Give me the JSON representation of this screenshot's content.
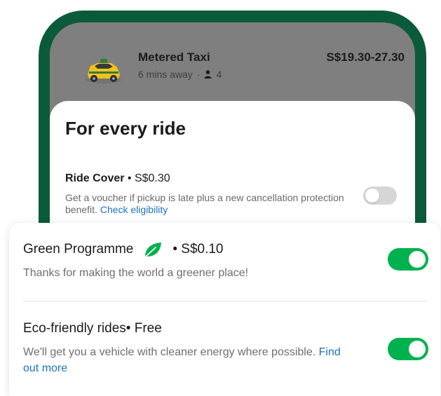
{
  "ride": {
    "name": "Metered Taxi",
    "eta": "6 mins away",
    "separator": "·",
    "seats": "4",
    "price": "S$19.30-27.30"
  },
  "sheet": {
    "title": "For every ride",
    "ride_cover": {
      "label": "Ride Cover",
      "price": " • S$0.30",
      "description": "Get a voucher if pickup is late plus a new cancellation protection benefit.",
      "link": "Check eligibility",
      "enabled": false
    }
  },
  "card": {
    "green_programme": {
      "label": "Green Programme",
      "price": "• S$0.10",
      "description": "Thanks for making the world a greener place!",
      "enabled": true
    },
    "eco_rides": {
      "label": "Eco-friendly rides",
      "price": " • Free",
      "description": "We'll get you a vehicle with cleaner energy where possible.",
      "link": "Find out more",
      "enabled": true
    }
  },
  "colors": {
    "brand_green": "#00b14f",
    "frame_green": "#0b5b3a",
    "link_blue": "#1e73be"
  },
  "icons": {
    "taxi": "taxi-icon",
    "person": "person-icon",
    "leaf": "leaf-icon"
  }
}
